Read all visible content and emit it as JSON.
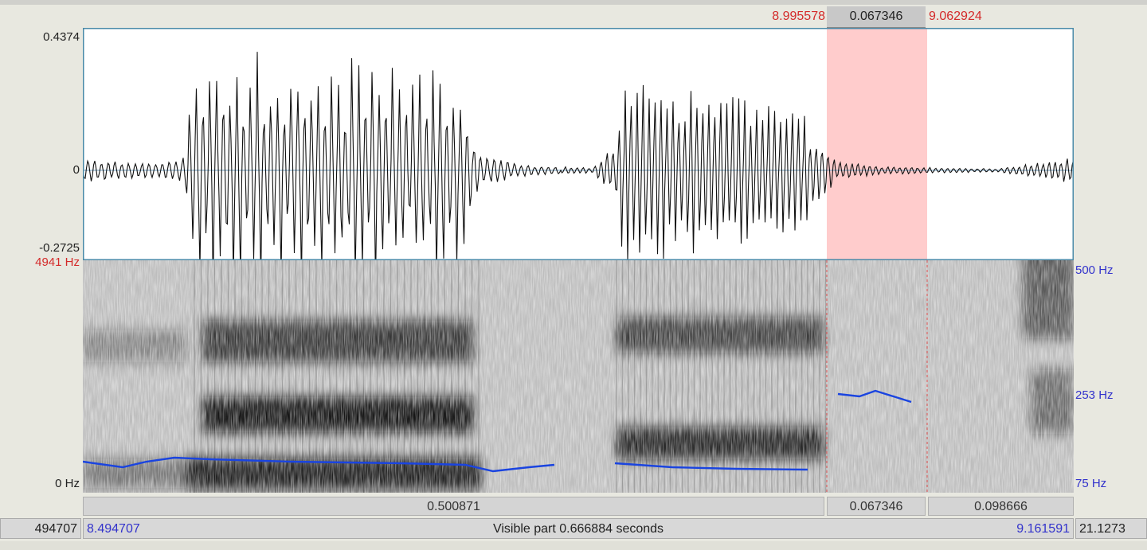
{
  "colors": {
    "selection_fill": "#ffcccc",
    "selection_text": "#d42a2a",
    "time_text": "#3333cc",
    "pitch_line": "#1a44e0",
    "waveform": "#111111",
    "waveform_frame": "#4a8aa8",
    "bar_bg": "#d4d4d4"
  },
  "selection": {
    "start": "8.995578",
    "duration": "0.067346",
    "end": "9.062924"
  },
  "waveform": {
    "max_label": "0.4374",
    "zero_label": "0",
    "min_label": "-0.2725"
  },
  "spectrogram": {
    "freq_top_label": "4941 Hz",
    "freq_bottom_label": "0 Hz"
  },
  "pitch": {
    "top_label": "500 Hz",
    "mid_label": "253 Hz",
    "bottom_label": "75 Hz"
  },
  "durations": {
    "before": "0.500871",
    "selected": "0.067346",
    "after": "0.098666"
  },
  "bottom_bar": {
    "total_start": "494707",
    "visible_start": "8.494707",
    "visible_label": "Visible part 0.666884 seconds",
    "visible_end": "9.161591",
    "total_end": "21.1273"
  }
}
